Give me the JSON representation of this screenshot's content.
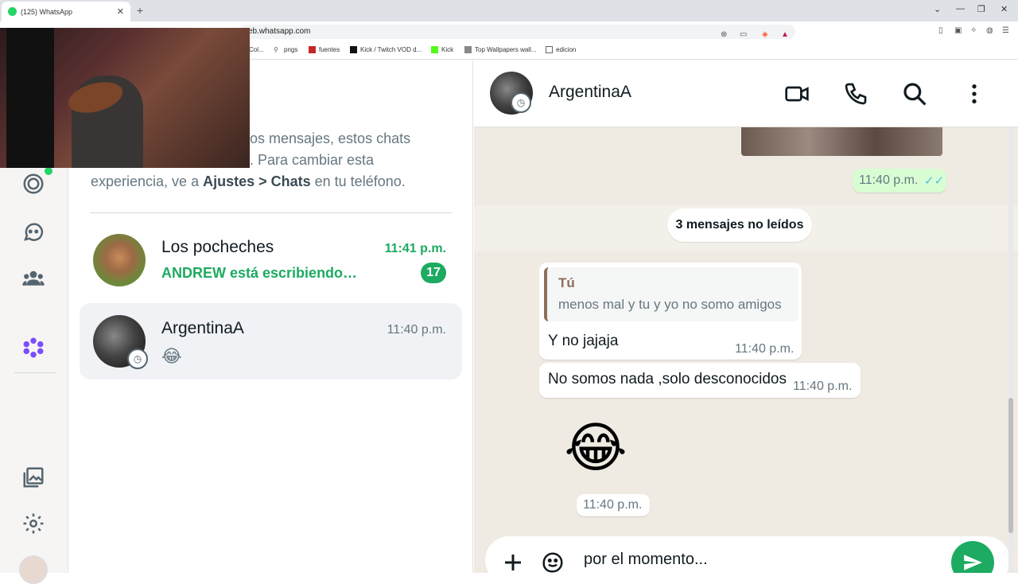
{
  "browser": {
    "tab_title": "(125) WhatsApp",
    "tab_close": "✕",
    "new_tab": "+",
    "url": "eb.whatsapp.com",
    "window_controls": [
      "⌄",
      "—",
      "❐",
      "✕"
    ],
    "bookmarks": [
      {
        "label": "Col..."
      },
      {
        "label": "pngs"
      },
      {
        "label": "fuentes"
      },
      {
        "label": "Kick / Twitch VOD d..."
      },
      {
        "label": "Kick"
      },
      {
        "label": "Top Wallpapers wall..."
      },
      {
        "label": "edicion"
      }
    ]
  },
  "sidebar": {
    "accent_color": "#25d366"
  },
  "chat_list": {
    "archived_info_line1": "os mensajes, estos chats",
    "archived_info_line2": ". Para cambiar esta",
    "archived_info_line3_prefix": "experiencia, ve a ",
    "archived_info_bold": "Ajustes > Chats",
    "archived_info_suffix": " en tu teléfono.",
    "chats": [
      {
        "name": "Los pocheches",
        "time": "11:41 p.m.",
        "preview": "ANDREW está escribiendo…",
        "unread": "17"
      },
      {
        "name": "ArgentinaA",
        "time": "11:40 p.m.",
        "preview": "😂"
      }
    ]
  },
  "conversation": {
    "contact_name": "ArgentinaA",
    "messages": {
      "outgoing_time": "11:40 p.m.",
      "outgoing_ticks": "✓✓",
      "unread_divider": "3 mensajes no leídos",
      "reply_quote_author": "Tú",
      "reply_quote_text": "menos mal y tu y yo no somo amigos",
      "reply_text": "Y no jajaja",
      "reply_time": "11:40 p.m.",
      "msg2_text": "No somos nada ,solo desconocidos",
      "msg2_time": "11:40 p.m.",
      "emoji": "😂",
      "emoji_time": "11:40 p.m."
    },
    "composer_text": "por el momento..."
  }
}
